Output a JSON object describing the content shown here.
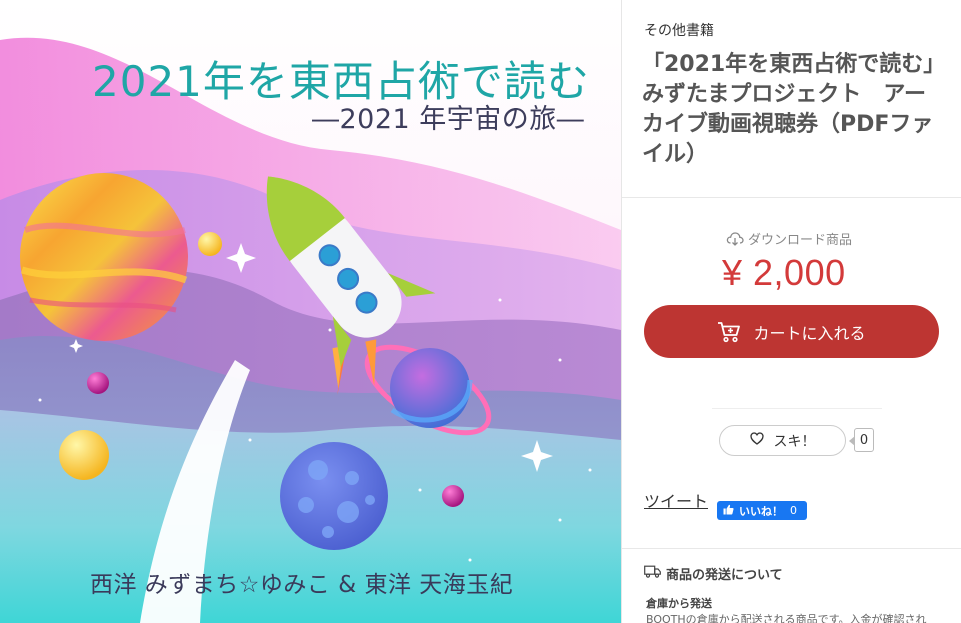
{
  "hero": {
    "title": "2021年を東西占術で読む",
    "subtitle": "―2021 年宇宙の旅―",
    "authors": "西洋 みずまち☆ゆみこ & 東洋 天海玉紀"
  },
  "product": {
    "category": "その他書籍",
    "title": "「2021年を東西占術で読む」みずたまプロジェクト　アーカイブ動画視聴券（PDFファイル）",
    "download_label": "ダウンロード商品",
    "price": "¥ 2,000",
    "cart_label": "カートに入れる"
  },
  "social": {
    "like_label": "スキ！",
    "like_count": "0",
    "tweet_label": "ツイート",
    "fb_label": "いいね！",
    "fb_count": "0"
  },
  "shipping": {
    "heading": "商品の発送について",
    "from": "倉庫から発送",
    "description": "BOOTHの倉庫から配送される商品です。入金が確認され"
  },
  "colors": {
    "accent": "#bd3532",
    "price": "#d33a3a",
    "title_teal": "#1fa6a6",
    "fb_blue": "#1877f2"
  },
  "icons": [
    "cloud-download-icon",
    "cart-icon",
    "heart-icon",
    "thumbs-up-icon",
    "truck-icon"
  ]
}
